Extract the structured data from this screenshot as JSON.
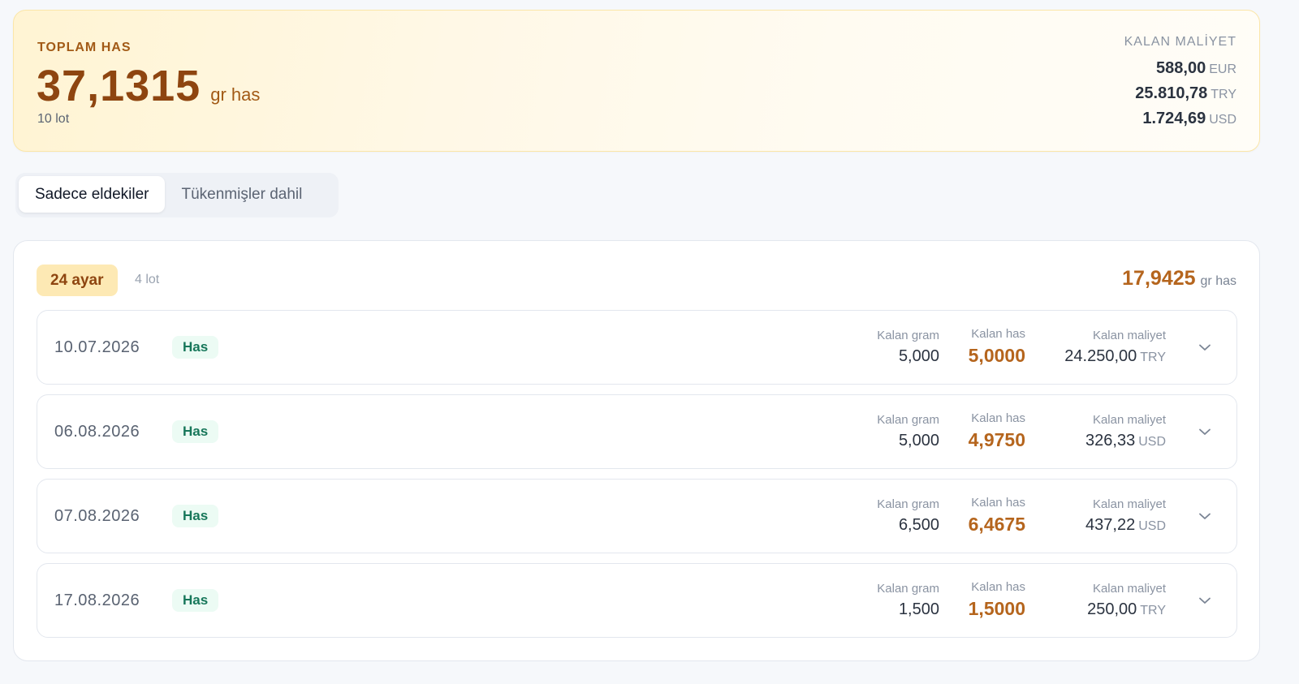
{
  "summary": {
    "label": "TOPLAM HAS",
    "total_value": "37,1315",
    "total_unit": "gr has",
    "lot_count": "10 lot",
    "cost_label": "KALAN MALİYET",
    "costs": [
      {
        "amount": "588,00",
        "currency": "EUR"
      },
      {
        "amount": "25.810,78",
        "currency": "TRY"
      },
      {
        "amount": "1.724,69",
        "currency": "USD"
      }
    ]
  },
  "filter": {
    "options": [
      "Sadece eldekiler",
      "Tükenmişler dahil"
    ],
    "selected": "Sadece eldekiler"
  },
  "group": {
    "badge": "24 ayar",
    "lot_count": "4 lot",
    "total_value": "17,9425",
    "total_unit": "gr has",
    "column_labels": {
      "gram": "Kalan gram",
      "has": "Kalan has",
      "cost": "Kalan maliyet"
    },
    "lots": [
      {
        "date": "10.07.2026",
        "type": "Has",
        "gram": "5,000",
        "has": "5,0000",
        "cost": "24.250,00",
        "currency": "TRY"
      },
      {
        "date": "06.08.2026",
        "type": "Has",
        "gram": "5,000",
        "has": "4,9750",
        "cost": "326,33",
        "currency": "USD"
      },
      {
        "date": "07.08.2026",
        "type": "Has",
        "gram": "6,500",
        "has": "6,4675",
        "cost": "437,22",
        "currency": "USD"
      },
      {
        "date": "17.08.2026",
        "type": "Has",
        "gram": "1,500",
        "has": "1,5000",
        "cost": "250,00",
        "currency": "TRY"
      }
    ]
  },
  "colors": {
    "accent_brown": "#8e4510",
    "accent_amber": "#b5651d",
    "badge_bg": "#fde9b4",
    "type_green": "#17775a"
  },
  "icons": {
    "expand": "chevron-down-icon"
  }
}
